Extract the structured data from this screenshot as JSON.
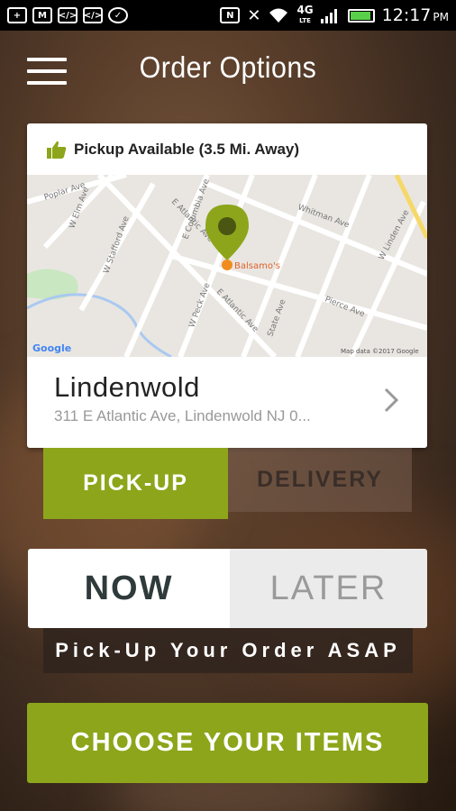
{
  "status_bar": {
    "icons": [
      "add-icon",
      "gmail-icon",
      "code-icon",
      "code-icon",
      "messenger-icon",
      "nfc-icon",
      "mute-icon",
      "wifi-icon",
      "4g-lte-icon",
      "signal-icon",
      "battery-icon"
    ],
    "network": "4G",
    "network_sub": "LTE",
    "time": "12:17",
    "ampm": "PM"
  },
  "header": {
    "title": "Order Options"
  },
  "location_card": {
    "pickup_status": "Pickup Available (3.5 Mi. Away)",
    "map": {
      "pin_label": "Balsamo's",
      "street_labels": [
        "Poplar Ave",
        "W Elm Ave",
        "W Stafford Ave",
        "E Atlantic Ave",
        "E Columbia Ave",
        "Whitman Ave",
        "W Linden Ave",
        "E Atlantic Ave",
        "W Peck Ave",
        "State Ave",
        "Pierce Ave"
      ],
      "google_logo": "Google",
      "attribution": "Map data ©2017 Google"
    },
    "name": "Lindenwold",
    "address": "311 E Atlantic Ave, Lindenwold NJ 0..."
  },
  "order_type": {
    "pickup_label": "PICK-UP",
    "delivery_label": "DELIVERY",
    "selected": "PICK-UP"
  },
  "timing": {
    "now_label": "NOW",
    "later_label": "LATER",
    "selected": "NOW",
    "message": "Pick-Up Your Order ASAP"
  },
  "cta": {
    "label": "CHOOSE YOUR ITEMS"
  },
  "colors": {
    "accent": "#8da51a",
    "map_bg": "#e9e6e1",
    "pin": "#8da51a"
  }
}
